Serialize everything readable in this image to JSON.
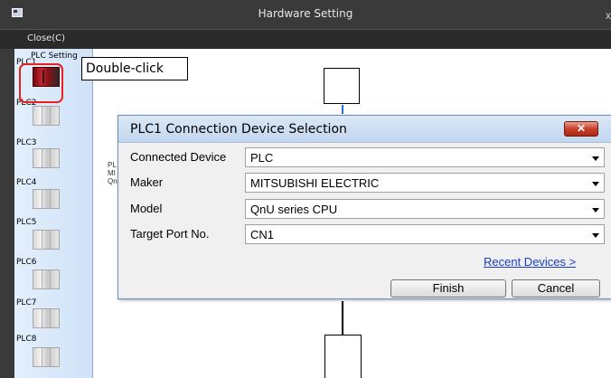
{
  "window": {
    "title": "Hardware Setting",
    "close_glyph": "x"
  },
  "menu": {
    "close_label": "Close(C)"
  },
  "sidebar": {
    "header": "PLC Setting",
    "items": [
      {
        "label": "PLC1",
        "icon": "plc-red-icon",
        "selected": true
      },
      {
        "label": "PLC2",
        "icon": "plc-gray-icon"
      },
      {
        "label": "PLC3",
        "icon": "plc-gray-icon"
      },
      {
        "label": "PLC4",
        "icon": "plc-gray-icon"
      },
      {
        "label": "PLC5",
        "icon": "plc-gray-icon"
      },
      {
        "label": "PLC6",
        "icon": "plc-gray-icon"
      },
      {
        "label": "PLC7",
        "icon": "plc-gray-icon"
      },
      {
        "label": "PLC8",
        "icon": "plc-gray-icon"
      }
    ]
  },
  "callout": {
    "text": "Double-click"
  },
  "canvas": {
    "background_text": [
      "PL",
      "MI",
      "Qn"
    ]
  },
  "dialog": {
    "title": "PLC1 Connection Device Selection",
    "close_glyph": "✕",
    "fields": [
      {
        "label": "Connected Device",
        "value": "PLC"
      },
      {
        "label": "Maker",
        "value": "MITSUBISHI ELECTRIC"
      },
      {
        "label": "Model",
        "value": "QnU series CPU"
      },
      {
        "label": "Target Port No.",
        "value": "CN1"
      }
    ],
    "recent_link": "Recent Devices >",
    "finish_label": "Finish",
    "cancel_label": "Cancel"
  },
  "colors": {
    "title_bar": "#3a3a3a",
    "highlight": "#e82020",
    "link": "#1a3ccc"
  }
}
